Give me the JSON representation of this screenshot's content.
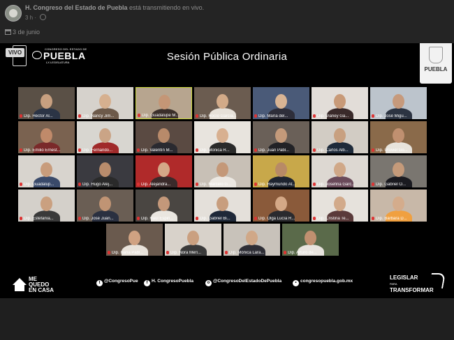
{
  "post": {
    "page_name": "H. Congreso del Estado de Puebla",
    "action": " está transmitiendo en vivo.",
    "time": "3 h",
    "date": "3 de junio"
  },
  "broadcast": {
    "live_badge": "VIVO",
    "logo_small": "CONGRESO DEL ESTADO DE",
    "logo_big": "PUEBLA",
    "logo_legislature": "LX LEGISLATURA",
    "title": "Sesión Pública Ordinaria",
    "seal_right_text": "PUEBLA",
    "participants": [
      {
        "label": "Dip. Héctor Al...",
        "bg": "#5a5046",
        "skin": "#c8a080",
        "shirt": "#2b3445"
      },
      {
        "label": "Dip. Nancy Jim...",
        "bg": "#d6d2cc",
        "skin": "#d6b08f",
        "shirt": "#6d5a4a"
      },
      {
        "label": "Dip. Guadalupe M...",
        "bg": "#b7a58f",
        "skin": "#c49676",
        "shirt": "#3a2f2a",
        "active": true
      },
      {
        "label": "Dip. Rocío García...",
        "bg": "#6b5c50",
        "skin": "#d2aa88",
        "shirt": "#e6e0d8"
      },
      {
        "label": "Dip. María del...",
        "bg": "#4a5a78",
        "skin": "#d8b494",
        "shirt": "#2e2e3a"
      },
      {
        "label": "Dip. Vianey Ga...",
        "bg": "#e2ddd8",
        "skin": "#c89a78",
        "shirt": "#3a2a2a"
      },
      {
        "label": "Dip. José Migu...",
        "bg": "#bcc4cc",
        "skin": "#c69a7c",
        "shirt": "#2c3442"
      },
      {
        "label": "Dip. Emilio Ernest...",
        "bg": "#7a6250",
        "skin": "#c08a6a",
        "shirt": "#7a2a2a"
      },
      {
        "label": "Dip. Fernando...",
        "bg": "#d8d6d0",
        "skin": "#caa486",
        "shirt": "#a02a2a"
      },
      {
        "label": "Dip. Valentín M...",
        "bg": "#5a4a42",
        "skin": "#b88a6a",
        "shirt": "#2a2a30"
      },
      {
        "label": "Dip. Mónica R...",
        "bg": "#e8e4de",
        "skin": "#d8b090",
        "shirt": "#2a2a2a"
      },
      {
        "label": "Dip. Juan Pabl...",
        "bg": "#6a6058",
        "skin": "#c49a7a",
        "shirt": "#222226"
      },
      {
        "label": "Dip. Carlos Alb...",
        "bg": "#d2ccc4",
        "skin": "#c8a080",
        "shirt": "#1e2a3a"
      },
      {
        "label": "Dip. Uruviel Go...",
        "bg": "#8a6a4a",
        "skin": "#c09070",
        "shirt": "#e8e4dc"
      },
      {
        "label": "Dip. Guadalup...",
        "bg": "#d8d4ce",
        "skin": "#c89c7c",
        "shirt": "#3a4a6a"
      },
      {
        "label": "Dip. Hugo Alej...",
        "bg": "#3a3a40",
        "skin": "#b88c6c",
        "shirt": "#2a2a2a"
      },
      {
        "label": "Dip. Alejandra...",
        "bg": "#b02a2a",
        "skin": "#d4a888",
        "shirt": "#3a2a2a"
      },
      {
        "label": "Dip. Marcelo G...",
        "bg": "#c8c0b6",
        "skin": "#c49878",
        "shirt": "#ece8e2"
      },
      {
        "label": "Dip. Raymundo At...",
        "bg": "#c8a84a",
        "skin": "#b88a66",
        "shirt": "#1e2430"
      },
      {
        "label": "Dip. Josefina Garc...",
        "bg": "#ddd8d2",
        "skin": "#d0a888",
        "shirt": "#6a4a5a"
      },
      {
        "label": "Dip. Gabriel O...",
        "bg": "#7a7670",
        "skin": "#c49a7a",
        "shirt": "#1a1a20"
      },
      {
        "label": "Dip. Estefanía...",
        "bg": "#d4d0ca",
        "skin": "#caa080",
        "shirt": "#3a3a3a"
      },
      {
        "label": "Dip. José Juan...",
        "bg": "#6a5e54",
        "skin": "#c09474",
        "shirt": "#2a3040"
      },
      {
        "label": "Dip. Raúl Espin...",
        "bg": "#4a4642",
        "skin": "#c4987a",
        "shirt": "#eae6e0"
      },
      {
        "label": "Dip. Gabriel Bi...",
        "bg": "#e4e0da",
        "skin": "#c89e7e",
        "shirt": "#1e2838"
      },
      {
        "label": "Dip. Olga Lucía R...",
        "bg": "#8a5a3a",
        "skin": "#d4a886",
        "shirt": "#2a2a2e"
      },
      {
        "label": "Dip. Cristina Te...",
        "bg": "#e6e2dc",
        "skin": "#d2aa8a",
        "shirt": "#5a3a3a"
      },
      {
        "label": "Dip. Bárbara D...",
        "bg": "#c8b8a8",
        "skin": "#d4ac8c",
        "shirt": "#f0a040"
      },
      {
        "label": "Dip. Iliana Pabl...",
        "bg": "#6a5a4e",
        "skin": "#d0a282",
        "shirt": "#e8e2da"
      },
      {
        "label": "Dip. Nora Merí...",
        "bg": "#d8d2ca",
        "skin": "#caa080",
        "shirt": "#3a3a3a"
      },
      {
        "label": "Dip. Mónica Lara...",
        "bg": "#c8c2ba",
        "skin": "#d0a888",
        "shirt": "#2e2e36"
      },
      {
        "label": "Dip. Arturo de...",
        "bg": "#5a6a4a",
        "skin": "#c09070",
        "shirt": "#e8e4de"
      }
    ],
    "footer": {
      "mqc_lines": [
        "ME",
        "QUEDO",
        "EN CASA"
      ],
      "twitter": "@CongresoPue",
      "facebook": "H. CongresoPuebla",
      "instagram": "@CongresoDelEstadoDePuebla",
      "web": "congresopuebla.gob.mx",
      "legislar_top": "LEGISLAR",
      "legislar_para": "PARA",
      "legislar_bottom": "TRANSFORMAR"
    }
  }
}
